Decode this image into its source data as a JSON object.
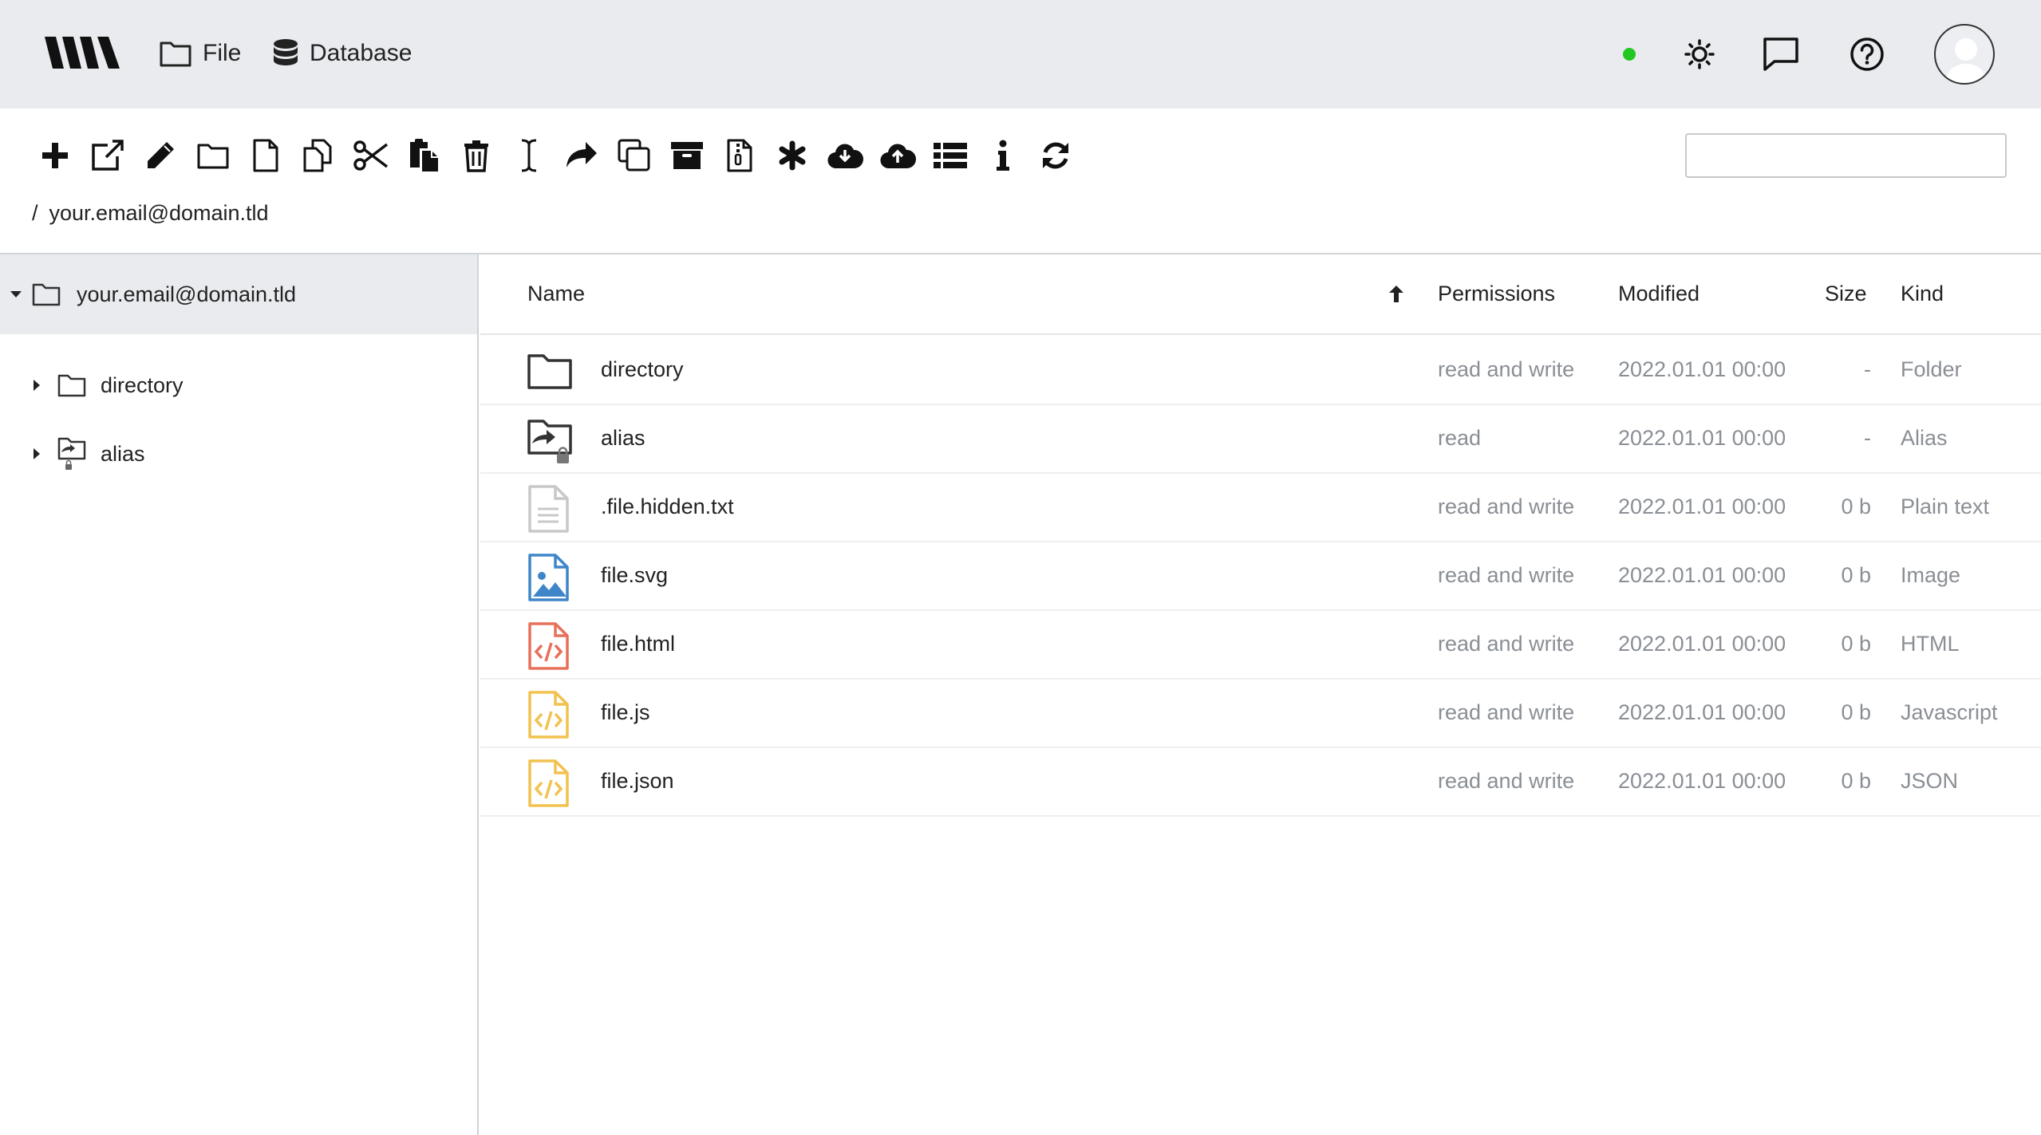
{
  "appbar": {
    "nav": [
      {
        "label": "File",
        "icon": "folder-icon"
      },
      {
        "label": "Database",
        "icon": "database-icon"
      }
    ],
    "status_color": "#22c722"
  },
  "toolbar": {
    "tools": [
      "plus-icon",
      "external-link-icon",
      "pencil-icon",
      "folder-icon",
      "file-icon",
      "copy-files-icon",
      "scissors-icon",
      "paste-icon",
      "trash-icon",
      "text-cursor-icon",
      "share-icon",
      "clone-icon",
      "archive-icon",
      "zip-file-icon",
      "asterisk-icon",
      "cloud-download-icon",
      "cloud-upload-icon",
      "list-icon",
      "info-icon",
      "refresh-icon"
    ],
    "search_value": ""
  },
  "breadcrumb": {
    "separator": "/",
    "path": "your.email@domain.tld"
  },
  "tree": {
    "root": "your.email@domain.tld",
    "children": [
      "directory",
      "alias"
    ]
  },
  "list": {
    "columns": {
      "name": "Name",
      "permissions": "Permissions",
      "modified": "Modified",
      "size": "Size",
      "kind": "Kind"
    },
    "rows": [
      {
        "name": "directory",
        "permissions": "read and write",
        "modified": "2022.01.01  00:00",
        "size": "-",
        "kind": "Folder",
        "icon": "folder-icon"
      },
      {
        "name": "alias",
        "permissions": "read",
        "modified": "2022.01.01  00:00",
        "size": "-",
        "kind": "Alias",
        "icon": "alias-folder-icon"
      },
      {
        "name": ".file.hidden.txt",
        "permissions": "read and write",
        "modified": "2022.01.01  00:00",
        "size": "0 b",
        "kind": "Plain text",
        "icon": "text-file-icon"
      },
      {
        "name": "file.svg",
        "permissions": "read and write",
        "modified": "2022.01.01  00:00",
        "size": "0 b",
        "kind": "Image",
        "icon": "image-file-icon"
      },
      {
        "name": "file.html",
        "permissions": "read and write",
        "modified": "2022.01.01  00:00",
        "size": "0 b",
        "kind": "HTML",
        "icon": "html-file-icon"
      },
      {
        "name": "file.js",
        "permissions": "read and write",
        "modified": "2022.01.01  00:00",
        "size": "0 b",
        "kind": "Javascript",
        "icon": "js-file-icon"
      },
      {
        "name": "file.json",
        "permissions": "read and write",
        "modified": "2022.01.01  00:00",
        "size": "0 b",
        "kind": "JSON",
        "icon": "json-file-icon"
      }
    ]
  },
  "colors": {
    "appbar_bg": "#e9ebef",
    "image_icon": "#3f86c8",
    "html_icon": "#e8705a",
    "js_icon": "#f2c24e",
    "muted_text": "#8a8f95"
  }
}
